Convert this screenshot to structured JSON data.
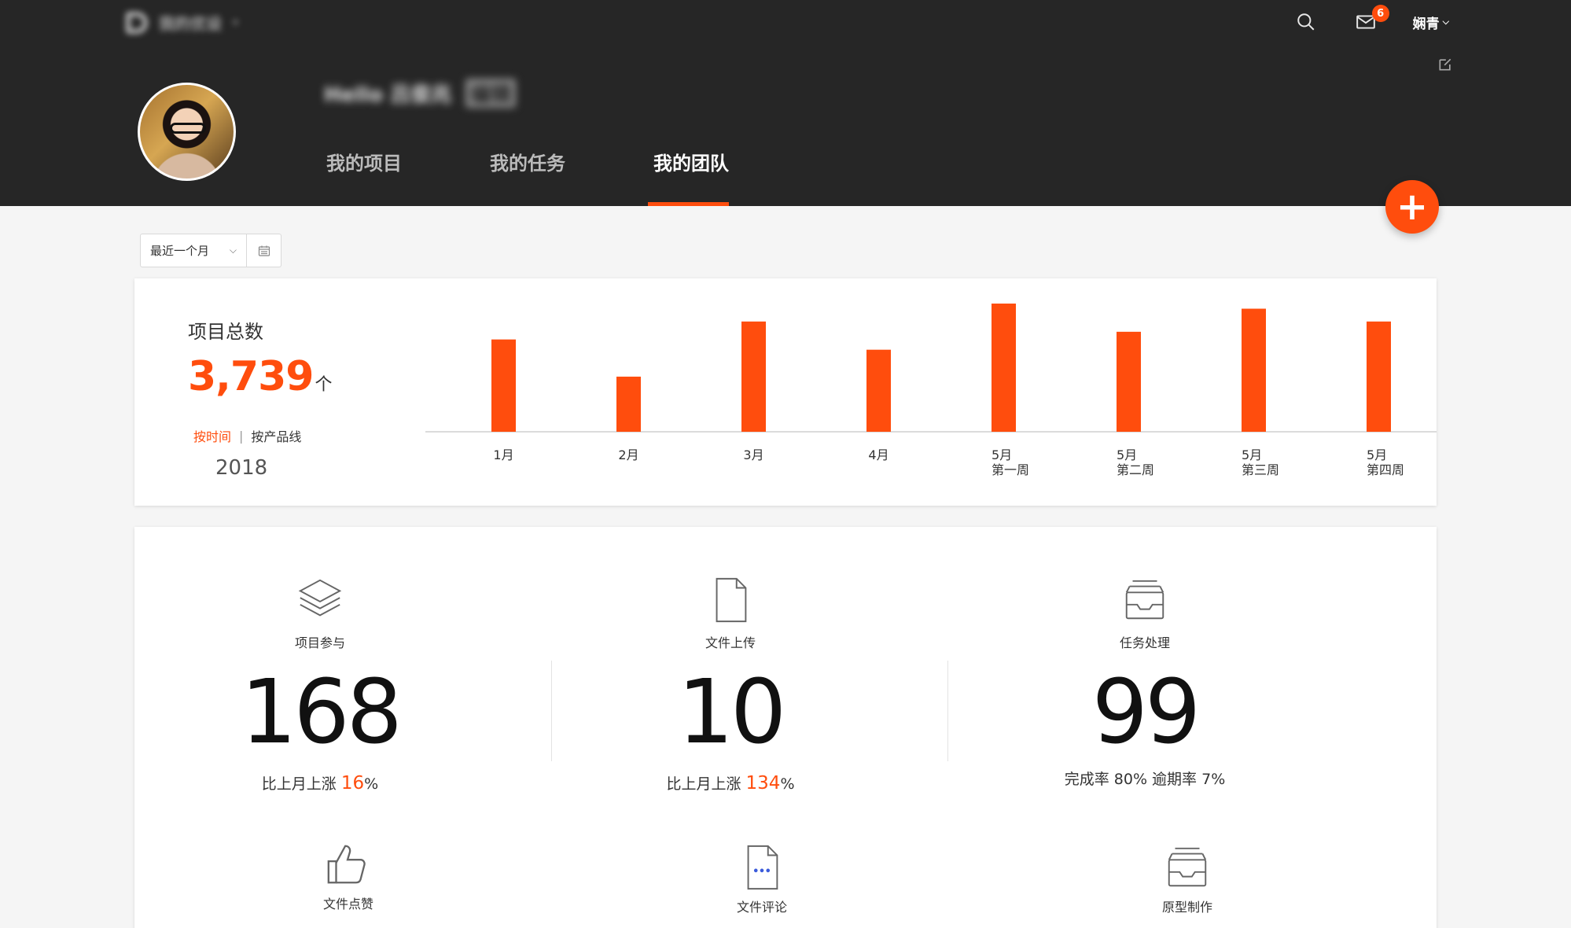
{
  "header": {
    "app_name": "我的优设",
    "greeting": "Hello 吕俊兆",
    "greeting_tag": "编辑",
    "mail_badge": "6",
    "user_name": "娴青",
    "tabs": [
      {
        "label": "我的项目",
        "active": false
      },
      {
        "label": "我的任务",
        "active": false
      },
      {
        "label": "我的团队",
        "active": true
      }
    ],
    "icons": {
      "search": "search-icon",
      "mail": "mail-icon",
      "edit": "edit-icon",
      "add": "plus-icon"
    }
  },
  "filter": {
    "selected": "最近一个月"
  },
  "summary": {
    "title": "项目总数",
    "value": "3,739",
    "unit": "个",
    "switch_time": "按时间",
    "switch_sep": "|",
    "switch_product": "按产品线",
    "year": "2018"
  },
  "chart_data": {
    "type": "bar",
    "categories": [
      "1月",
      "2月",
      "3月",
      "4月",
      "5月 第一周",
      "5月 第二周",
      "5月 第三周",
      "5月 第四周"
    ],
    "values": [
      72,
      43,
      86,
      64,
      100,
      78,
      96,
      86
    ],
    "color": "#ff4d0d",
    "grid": false
  },
  "stats": [
    {
      "label": "项目参与",
      "value": "168",
      "sub_prefix": "比上月上涨 ",
      "sub_highlight": "16",
      "sub_suffix": "%",
      "icon": "layers-icon"
    },
    {
      "label": "文件上传",
      "value": "10",
      "sub_prefix": "比上月上涨 ",
      "sub_highlight": "134",
      "sub_suffix": "%",
      "icon": "file-icon"
    },
    {
      "label": "任务处理",
      "value": "99",
      "sub_text": "完成率 80%   逾期率 7%",
      "icon": "inbox-icon"
    }
  ],
  "more_stats": [
    {
      "label": "文件点赞",
      "icon": "thumbs-up-icon"
    },
    {
      "label": "文件评论",
      "icon": "file-comment-icon"
    },
    {
      "label": "原型制作",
      "icon": "inbox-stack-icon"
    }
  ],
  "accent": "#ff4d0d"
}
